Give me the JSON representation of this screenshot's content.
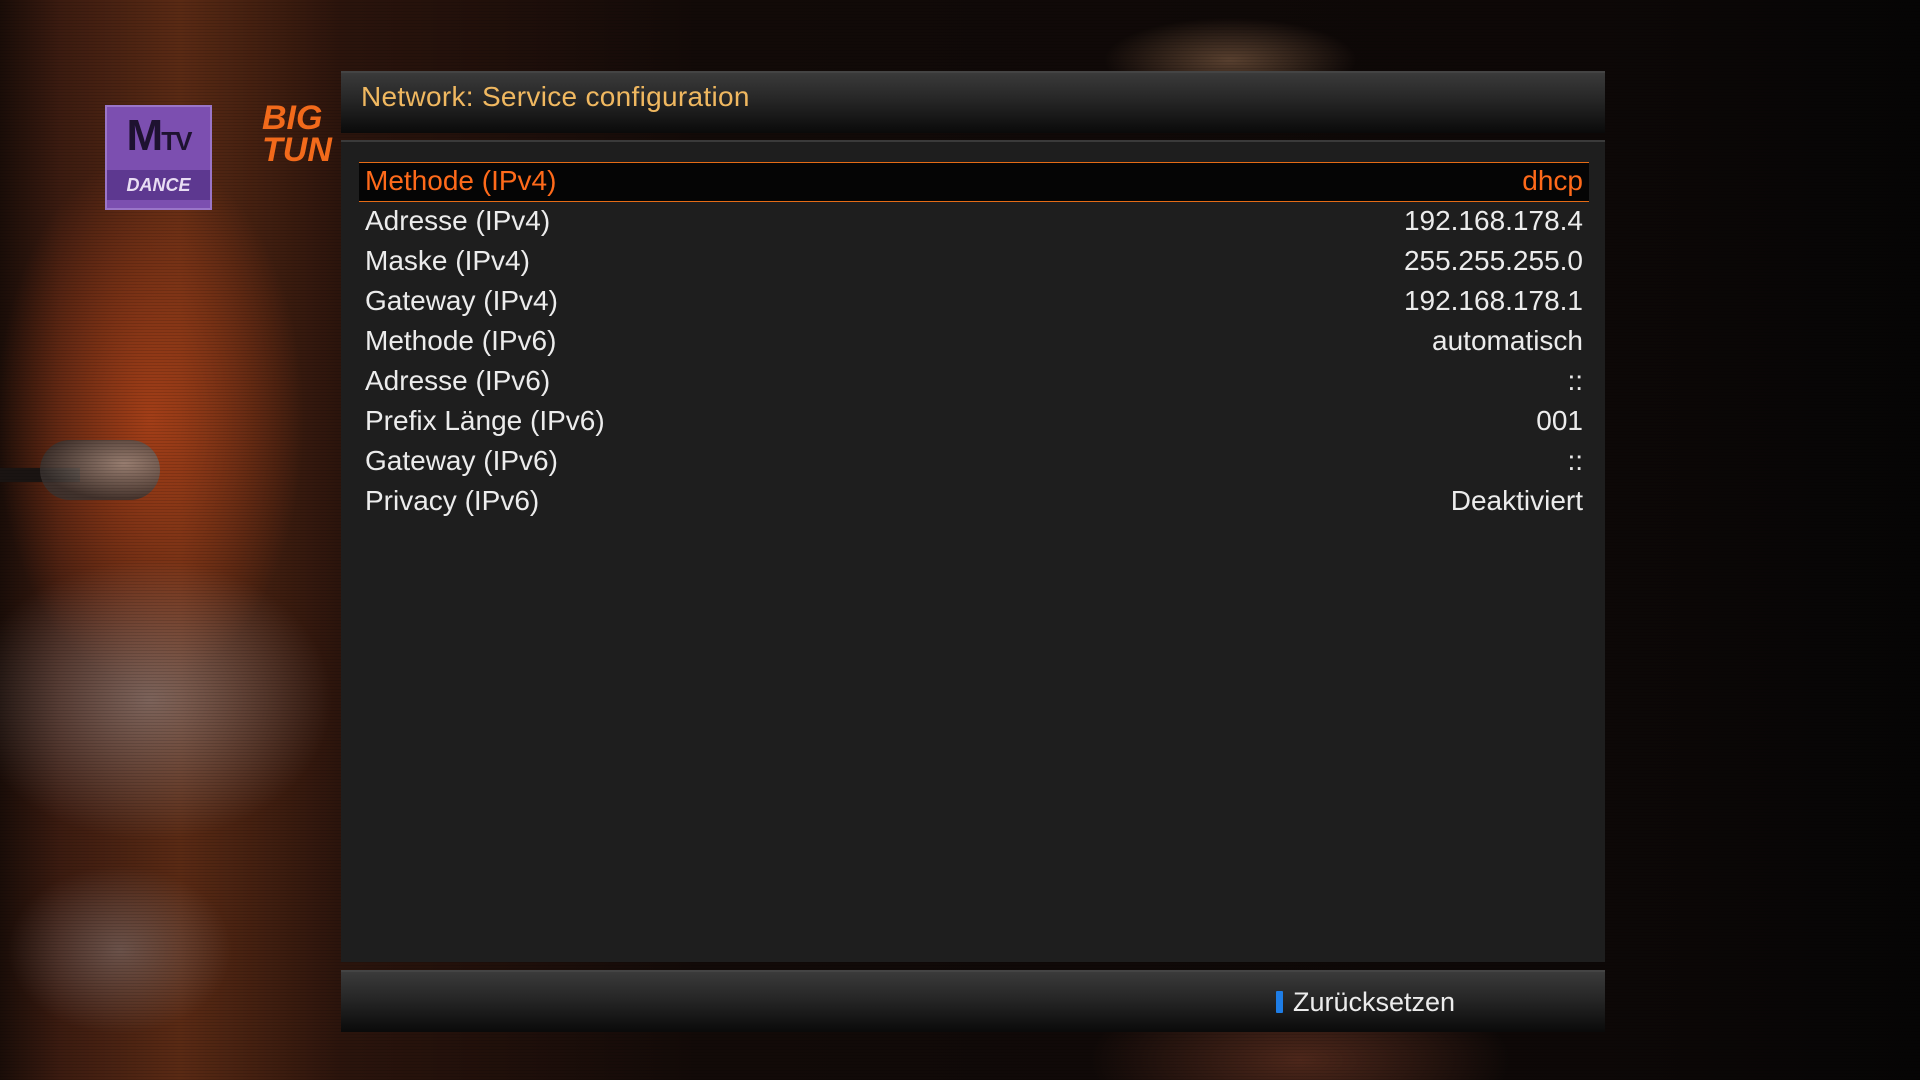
{
  "window": {
    "title": "Network: Service configuration"
  },
  "channel_logos": {
    "mtv_main": "M",
    "mtv_tv": "TV",
    "mtv_sub": "DANCE",
    "program_logo": "BIG TUN"
  },
  "config": {
    "selected_index": 0,
    "rows": [
      {
        "label": "Methode (IPv4)",
        "value": "dhcp"
      },
      {
        "label": "Adresse (IPv4)",
        "value": "192.168.178.4"
      },
      {
        "label": "Maske (IPv4)",
        "value": "255.255.255.0"
      },
      {
        "label": "Gateway (IPv4)",
        "value": "192.168.178.1"
      },
      {
        "label": "Methode (IPv6)",
        "value": "automatisch"
      },
      {
        "label": "Adresse (IPv6)",
        "value": "::"
      },
      {
        "label": "Prefix Länge (IPv6)",
        "value": "001"
      },
      {
        "label": "Gateway (IPv6)",
        "value": "::"
      },
      {
        "label": "Privacy (IPv6)",
        "value": "Deaktiviert"
      }
    ]
  },
  "buttons": {
    "blue": {
      "label": "Zurücksetzen",
      "icon": "blue-key-icon",
      "color": "#1e7de6"
    }
  },
  "colors": {
    "title": "#f0b860",
    "selection_text": "#ff6a1a",
    "selection_border": "#e46b16",
    "text": "#ececec"
  }
}
